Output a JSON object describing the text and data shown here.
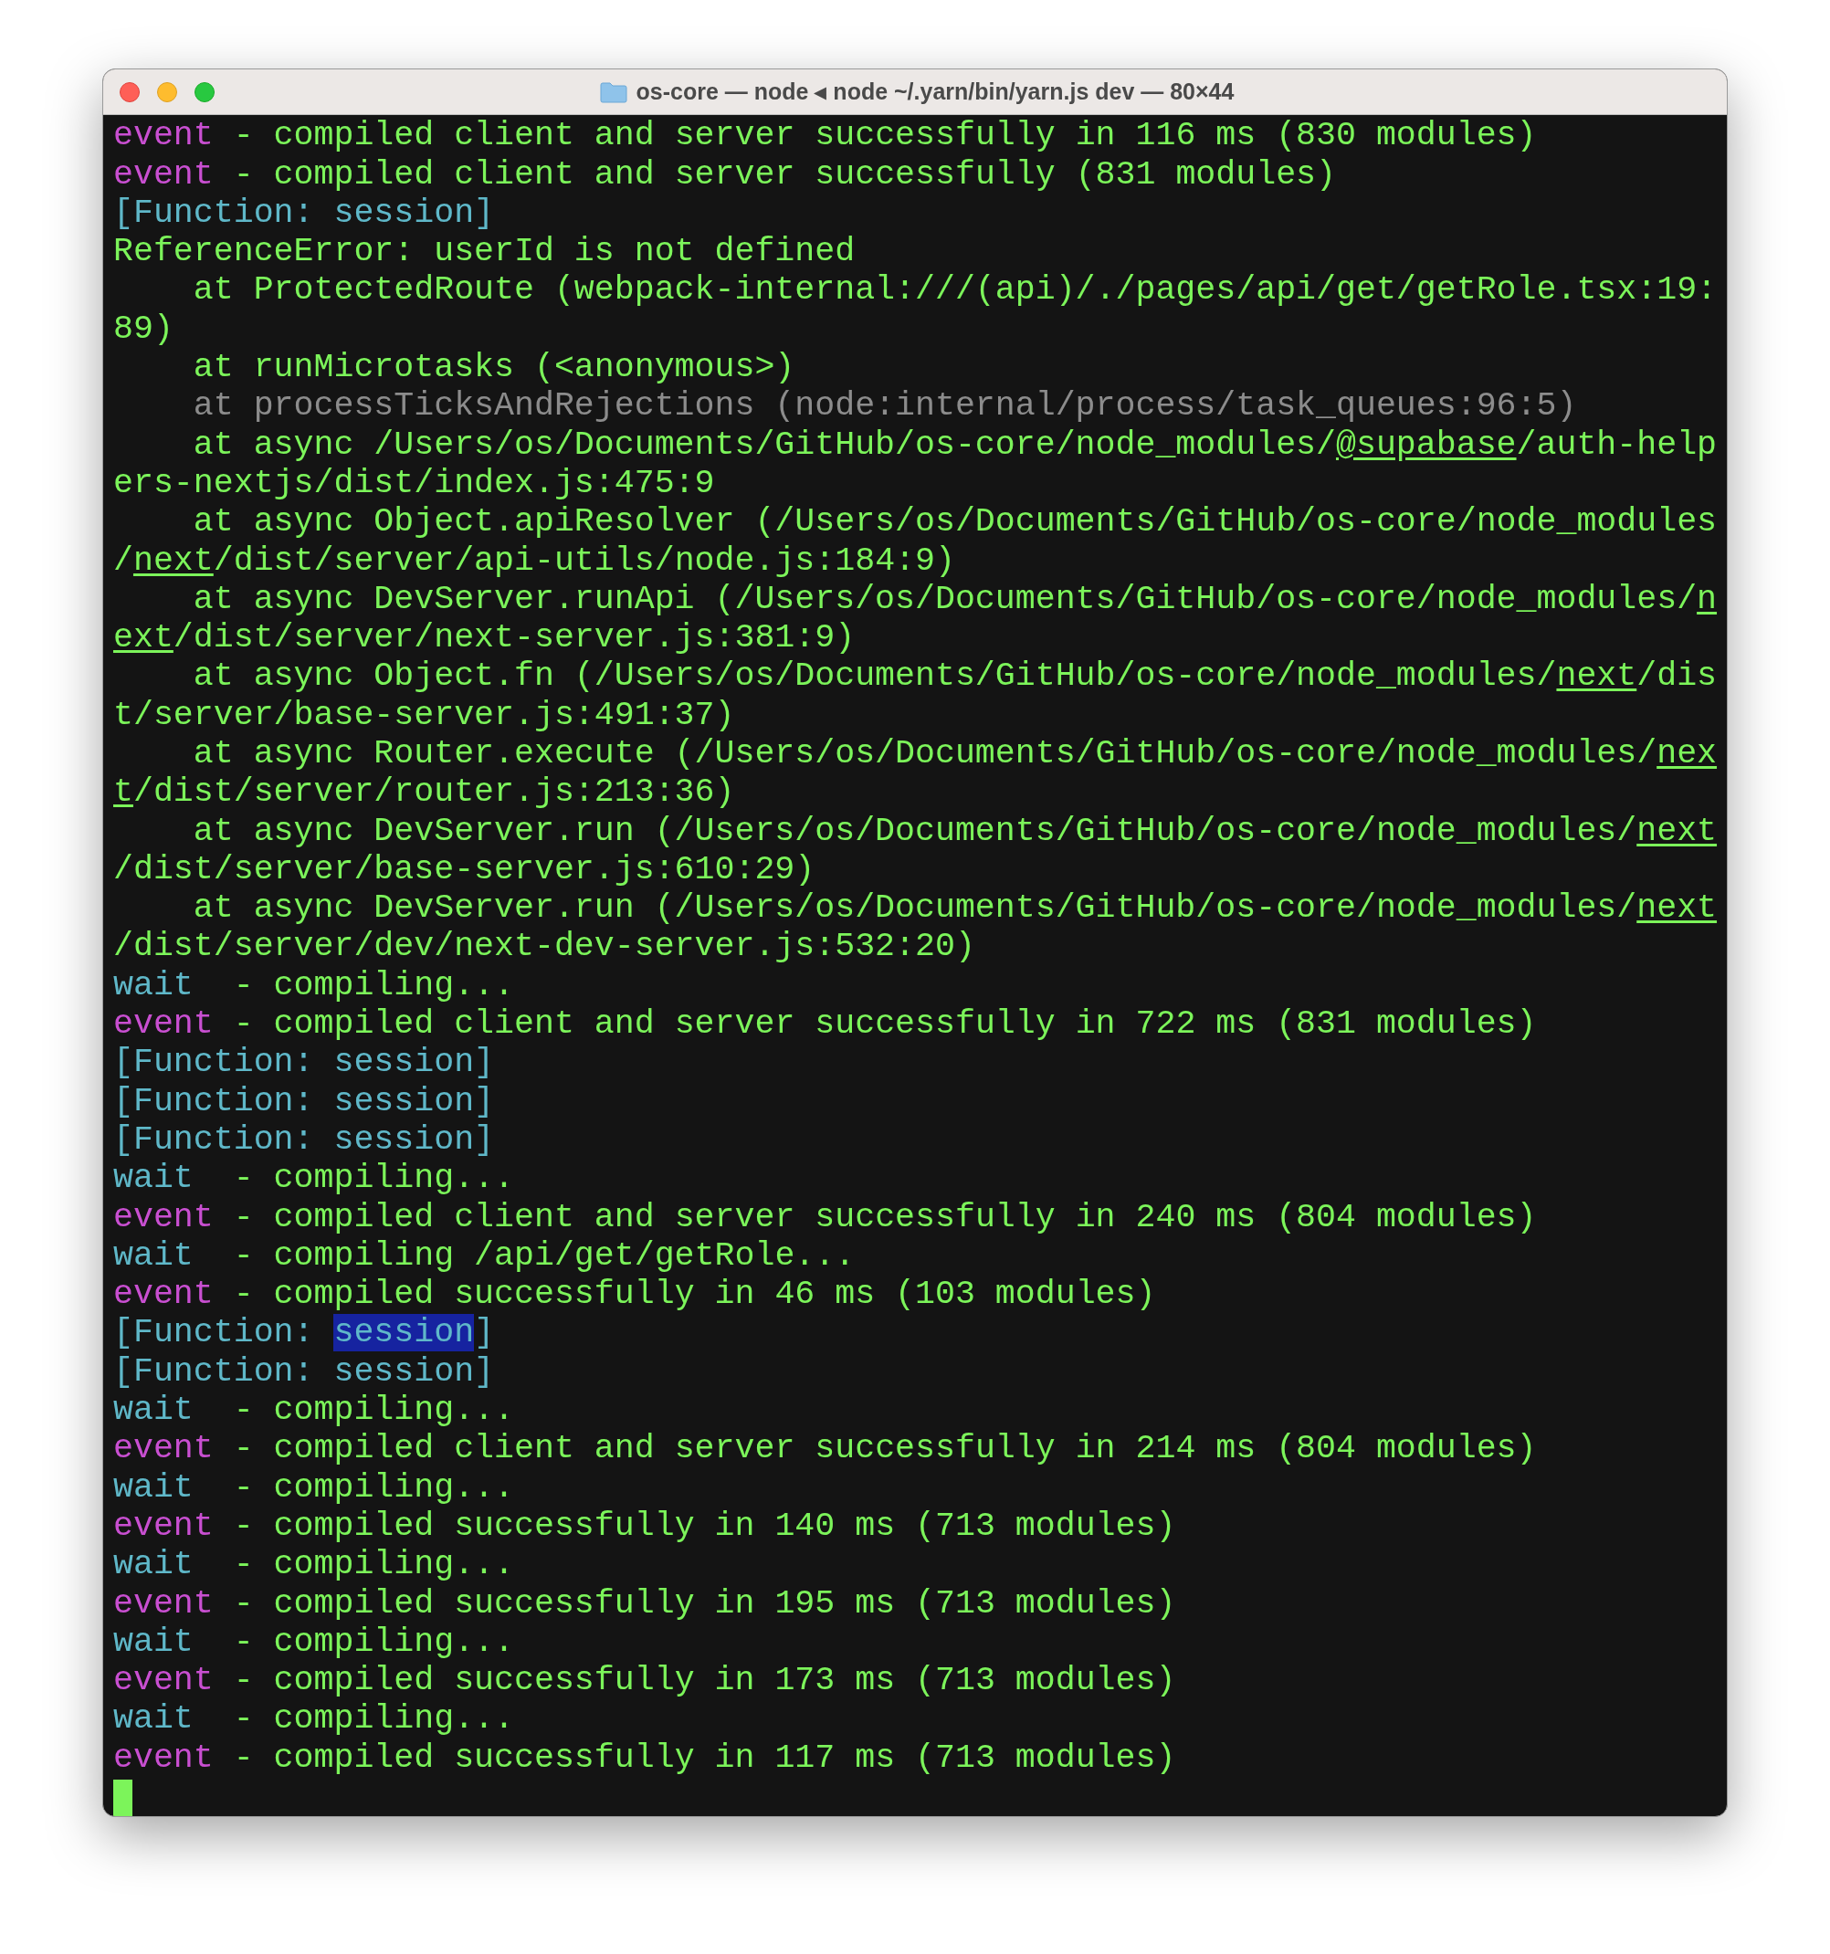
{
  "window": {
    "title": "os-core — node ◂ node ~/.yarn/bin/yarn.js dev — 80×44"
  },
  "terminal": {
    "rows": [
      {
        "segments": [
          {
            "kind": "event",
            "text": "event"
          },
          {
            "kind": "text",
            "text": " - compiled client and server successfully in 116 ms (830 modules)"
          }
        ]
      },
      {
        "segments": [
          {
            "kind": "event",
            "text": "event"
          },
          {
            "kind": "text",
            "text": " - compiled client and server successfully (831 modules)"
          }
        ]
      },
      {
        "segments": [
          {
            "kind": "func",
            "text": "[Function: session]"
          }
        ]
      },
      {
        "segments": [
          {
            "kind": "text",
            "text": "ReferenceError: userId is not defined"
          }
        ]
      },
      {
        "segments": [
          {
            "kind": "text",
            "text": "    at ProtectedRoute (webpack-internal:///(api)/./pages/api/get/getRole.tsx:19:"
          }
        ]
      },
      {
        "segments": [
          {
            "kind": "text",
            "text": "89)"
          }
        ]
      },
      {
        "segments": [
          {
            "kind": "text",
            "text": "    at runMicrotasks (<anonymous>)"
          }
        ]
      },
      {
        "segments": [
          {
            "kind": "dim",
            "text": "    at processTicksAndRejections (node:internal/process/task_queues:96:5)"
          }
        ]
      },
      {
        "segments": [
          {
            "kind": "text",
            "text": "    at async /Users/os/Documents/GitHub/os-core/node_modules/"
          },
          {
            "kind": "link",
            "text": "@supabase"
          },
          {
            "kind": "text",
            "text": "/auth-help"
          }
        ]
      },
      {
        "segments": [
          {
            "kind": "text",
            "text": "ers-nextjs/dist/index.js:475:9"
          }
        ]
      },
      {
        "segments": [
          {
            "kind": "text",
            "text": "    at async Object.apiResolver (/Users/os/Documents/GitHub/os-core/node_modules"
          }
        ]
      },
      {
        "segments": [
          {
            "kind": "text",
            "text": "/"
          },
          {
            "kind": "link",
            "text": "next"
          },
          {
            "kind": "text",
            "text": "/dist/server/api-utils/node.js:184:9)"
          }
        ]
      },
      {
        "segments": [
          {
            "kind": "text",
            "text": "    at async DevServer.runApi (/Users/os/Documents/GitHub/os-core/node_modules/"
          },
          {
            "kind": "link",
            "text": "n"
          }
        ]
      },
      {
        "segments": [
          {
            "kind": "link",
            "text": "ext"
          },
          {
            "kind": "text",
            "text": "/dist/server/next-server.js:381:9)"
          }
        ]
      },
      {
        "segments": [
          {
            "kind": "text",
            "text": "    at async Object.fn (/Users/os/Documents/GitHub/os-core/node_modules/"
          },
          {
            "kind": "link",
            "text": "next"
          },
          {
            "kind": "text",
            "text": "/dis"
          }
        ]
      },
      {
        "segments": [
          {
            "kind": "text",
            "text": "t/server/base-server.js:491:37)"
          }
        ]
      },
      {
        "segments": [
          {
            "kind": "text",
            "text": "    at async Router.execute (/Users/os/Documents/GitHub/os-core/node_modules/"
          },
          {
            "kind": "link",
            "text": "nex"
          }
        ]
      },
      {
        "segments": [
          {
            "kind": "link",
            "text": "t"
          },
          {
            "kind": "text",
            "text": "/dist/server/router.js:213:36)"
          }
        ]
      },
      {
        "segments": [
          {
            "kind": "text",
            "text": "    at async DevServer.run (/Users/os/Documents/GitHub/os-core/node_modules/"
          },
          {
            "kind": "link",
            "text": "next"
          }
        ]
      },
      {
        "segments": [
          {
            "kind": "text",
            "text": "/dist/server/base-server.js:610:29)"
          }
        ]
      },
      {
        "segments": [
          {
            "kind": "text",
            "text": "    at async DevServer.run (/Users/os/Documents/GitHub/os-core/node_modules/"
          },
          {
            "kind": "link",
            "text": "next"
          }
        ]
      },
      {
        "segments": [
          {
            "kind": "text",
            "text": "/dist/server/dev/next-dev-server.js:532:20)"
          }
        ]
      },
      {
        "segments": [
          {
            "kind": "wait",
            "text": "wait"
          },
          {
            "kind": "text",
            "text": "  - compiling..."
          }
        ]
      },
      {
        "segments": [
          {
            "kind": "event",
            "text": "event"
          },
          {
            "kind": "text",
            "text": " - compiled client and server successfully in 722 ms (831 modules)"
          }
        ]
      },
      {
        "segments": [
          {
            "kind": "func",
            "text": "[Function: session]"
          }
        ]
      },
      {
        "segments": [
          {
            "kind": "func",
            "text": "[Function: session]"
          }
        ]
      },
      {
        "segments": [
          {
            "kind": "func",
            "text": "[Function: session]"
          }
        ]
      },
      {
        "segments": [
          {
            "kind": "wait",
            "text": "wait"
          },
          {
            "kind": "text",
            "text": "  - compiling..."
          }
        ]
      },
      {
        "segments": [
          {
            "kind": "event",
            "text": "event"
          },
          {
            "kind": "text",
            "text": " - compiled client and server successfully in 240 ms (804 modules)"
          }
        ]
      },
      {
        "segments": [
          {
            "kind": "wait",
            "text": "wait"
          },
          {
            "kind": "text",
            "text": "  - compiling /api/get/getRole..."
          }
        ]
      },
      {
        "segments": [
          {
            "kind": "event",
            "text": "event"
          },
          {
            "kind": "text",
            "text": " - compiled successfully in 46 ms (103 modules)"
          }
        ]
      },
      {
        "segments": [
          {
            "kind": "func",
            "text": "[Function: "
          },
          {
            "kind": "selected",
            "text": "session"
          },
          {
            "kind": "func",
            "text": "]"
          }
        ]
      },
      {
        "segments": [
          {
            "kind": "func",
            "text": "[Function: session]"
          }
        ]
      },
      {
        "segments": [
          {
            "kind": "wait",
            "text": "wait"
          },
          {
            "kind": "text",
            "text": "  - compiling..."
          }
        ]
      },
      {
        "segments": [
          {
            "kind": "event",
            "text": "event"
          },
          {
            "kind": "text",
            "text": " - compiled client and server successfully in 214 ms (804 modules)"
          }
        ]
      },
      {
        "segments": [
          {
            "kind": "wait",
            "text": "wait"
          },
          {
            "kind": "text",
            "text": "  - compiling..."
          }
        ]
      },
      {
        "segments": [
          {
            "kind": "event",
            "text": "event"
          },
          {
            "kind": "text",
            "text": " - compiled successfully in 140 ms (713 modules)"
          }
        ]
      },
      {
        "segments": [
          {
            "kind": "wait",
            "text": "wait"
          },
          {
            "kind": "text",
            "text": "  - compiling..."
          }
        ]
      },
      {
        "segments": [
          {
            "kind": "event",
            "text": "event"
          },
          {
            "kind": "text",
            "text": " - compiled successfully in 195 ms (713 modules)"
          }
        ]
      },
      {
        "segments": [
          {
            "kind": "wait",
            "text": "wait"
          },
          {
            "kind": "text",
            "text": "  - compiling..."
          }
        ]
      },
      {
        "segments": [
          {
            "kind": "event",
            "text": "event"
          },
          {
            "kind": "text",
            "text": " - compiled successfully in 173 ms (713 modules)"
          }
        ]
      },
      {
        "segments": [
          {
            "kind": "wait",
            "text": "wait"
          },
          {
            "kind": "text",
            "text": "  - compiling..."
          }
        ]
      },
      {
        "segments": [
          {
            "kind": "event",
            "text": "event"
          },
          {
            "kind": "text",
            "text": " - compiled successfully in 117 ms (713 modules)"
          }
        ]
      }
    ]
  }
}
